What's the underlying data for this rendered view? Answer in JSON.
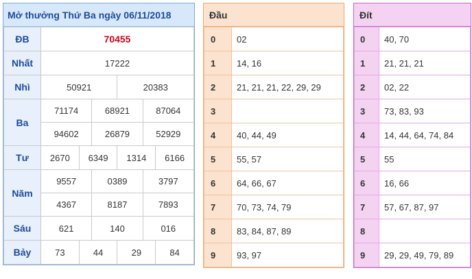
{
  "results": {
    "title": "Mở thưởng Thứ Ba ngày 06/11/2018",
    "rows": {
      "db": {
        "label": "ĐB",
        "values": [
          "70455"
        ]
      },
      "nhat": {
        "label": "Nhất",
        "values": [
          "17222"
        ]
      },
      "nhi": {
        "label": "Nhì",
        "values": [
          "50921",
          "20383"
        ]
      },
      "ba": {
        "label": "Ba",
        "values": [
          "71174",
          "68921",
          "87064",
          "94602",
          "26879",
          "52929"
        ]
      },
      "tu": {
        "label": "Tư",
        "values": [
          "2670",
          "6349",
          "1314",
          "6166"
        ]
      },
      "nam": {
        "label": "Năm",
        "values": [
          "9557",
          "0389",
          "3797",
          "4367",
          "8187",
          "7893"
        ]
      },
      "sau": {
        "label": "Sáu",
        "values": [
          "621",
          "140",
          "016"
        ]
      },
      "bay": {
        "label": "Bảy",
        "values": [
          "73",
          "44",
          "29",
          "84"
        ]
      }
    }
  },
  "dau": {
    "title": "Đầu",
    "rows": [
      {
        "num": "0",
        "val": "02"
      },
      {
        "num": "1",
        "val": "14, 16"
      },
      {
        "num": "2",
        "val": "21, 21, 21, 22, 29, 29"
      },
      {
        "num": "3",
        "val": ""
      },
      {
        "num": "4",
        "val": "40, 44, 49"
      },
      {
        "num": "5",
        "val": "55, 57"
      },
      {
        "num": "6",
        "val": "64, 66, 67"
      },
      {
        "num": "7",
        "val": "70, 73, 74, 79"
      },
      {
        "num": "8",
        "val": "83, 84, 87, 89"
      },
      {
        "num": "9",
        "val": "93, 97"
      }
    ]
  },
  "dit": {
    "title": "Đít",
    "rows": [
      {
        "num": "0",
        "val": "40, 70"
      },
      {
        "num": "1",
        "val": "21, 21, 21"
      },
      {
        "num": "2",
        "val": "02, 22"
      },
      {
        "num": "3",
        "val": "73, 83, 93"
      },
      {
        "num": "4",
        "val": "14, 44, 64, 74, 84"
      },
      {
        "num": "5",
        "val": "55"
      },
      {
        "num": "6",
        "val": "16, 66"
      },
      {
        "num": "7",
        "val": "57, 67, 87, 97"
      },
      {
        "num": "8",
        "val": ""
      },
      {
        "num": "9",
        "val": "29, 29, 49, 79, 89"
      }
    ]
  },
  "colors": {
    "special_prize": "#d0021b",
    "results_accent": "#79a9dc",
    "dau_accent": "#f0a768",
    "dit_accent": "#cc63c9"
  }
}
